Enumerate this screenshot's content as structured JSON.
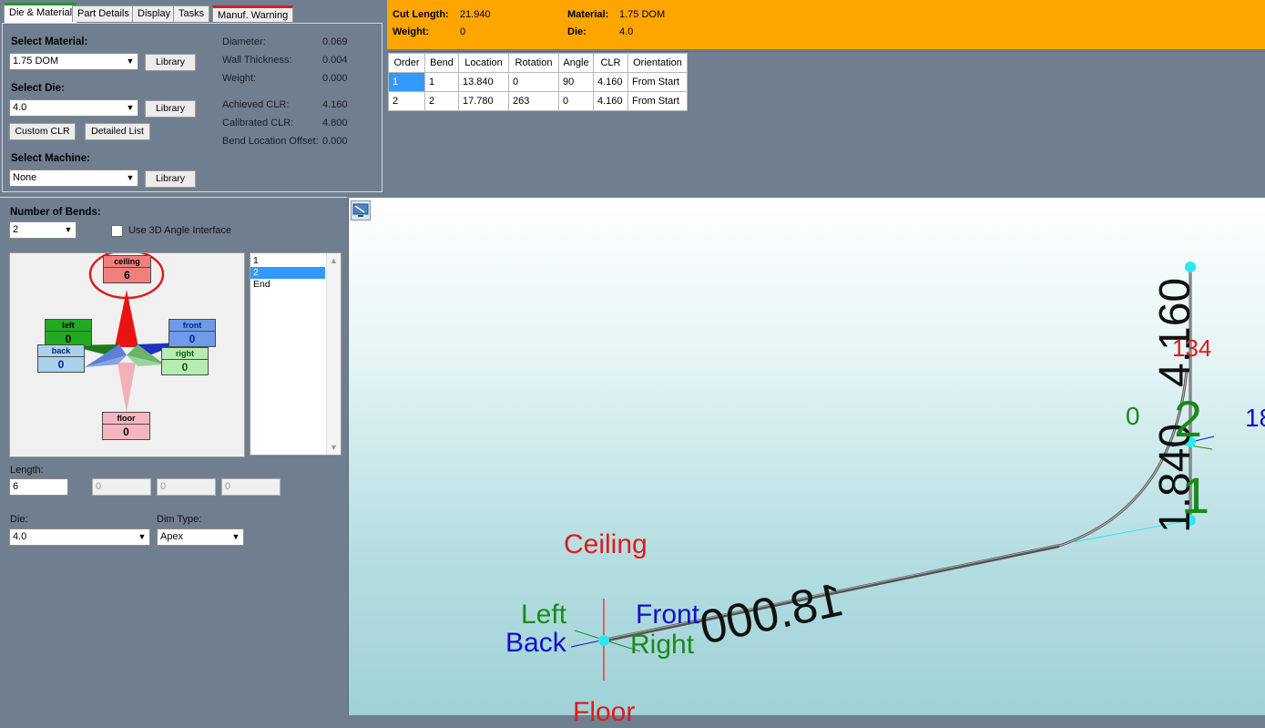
{
  "tabs": [
    {
      "label": "Die & Material"
    },
    {
      "label": "Part Details"
    },
    {
      "label": "Display"
    },
    {
      "label": "Tasks"
    },
    {
      "label": "Manuf. Warning"
    }
  ],
  "material": {
    "select_material_label": "Select Material:",
    "material_value": "1.75 DOM",
    "select_die_label": "Select Die:",
    "die_value": "4.0",
    "select_machine_label": "Select Machine:",
    "machine_value": "None",
    "library_label": "Library",
    "custom_clr_label": "Custom CLR",
    "detailed_list_label": "Detailed List"
  },
  "props": [
    {
      "label": "Diameter:",
      "value": "0.069"
    },
    {
      "label": "Wall Thickness:",
      "value": "0.004"
    },
    {
      "label": "Weight:",
      "value": "0.000"
    },
    {
      "label": "Achieved CLR:",
      "value": "4.160"
    },
    {
      "label": "Calibrated CLR:",
      "value": "4.800"
    },
    {
      "label": "Bend Location Offset:",
      "value": "0.000"
    }
  ],
  "info": {
    "cut_length_label": "Cut Length:",
    "cut_length_value": "21.940",
    "weight_label": "Weight:",
    "weight_value": "0",
    "material_label": "Material:",
    "material_value": "1.75 DOM",
    "die_label": "Die:",
    "die_value": "4.0"
  },
  "bend_table": {
    "headers": [
      "Order",
      "Bend",
      "Location",
      "Rotation",
      "Angle",
      "CLR",
      "Orientation"
    ],
    "rows": [
      [
        "1",
        "1",
        "13.840",
        "0",
        "90",
        "4.160",
        "From Start"
      ],
      [
        "2",
        "2",
        "17.780",
        "263",
        "0",
        "4.160",
        "From Start"
      ]
    ]
  },
  "bends_panel": {
    "number_of_bends_label": "Number of Bends:",
    "number_of_bends_value": "2",
    "use_3d_label": "Use 3D Angle Interface",
    "directions": {
      "ceiling": {
        "label": "ceiling",
        "value": "6",
        "color": "#f08080"
      },
      "left": {
        "label": "left",
        "value": "0",
        "color": "#22aa22"
      },
      "front": {
        "label": "front",
        "value": "0",
        "color": "#6f9ae8"
      },
      "back": {
        "label": "back",
        "value": "0",
        "color": "#a9d1ec"
      },
      "right": {
        "label": "right",
        "value": "0",
        "color": "#b5ecb0"
      },
      "floor": {
        "label": "floor",
        "value": "0",
        "color": "#f5b6c4"
      }
    },
    "list_items": [
      "1",
      "2",
      "End"
    ],
    "length_label": "Length:",
    "length_value": "6",
    "disabled_values": [
      "0",
      "0",
      "0"
    ],
    "die_label": "Die:",
    "die_value": "4.0",
    "dim_type_label": "Dim Type:",
    "dim_type_value": "Apex"
  },
  "view": {
    "ceiling": "Ceiling",
    "floor": "Floor",
    "left": "Left",
    "back": "Back",
    "front": "Front",
    "right": "Right",
    "dim_long": "18.000",
    "dim_vertical": "1.840",
    "dim_clr": "4.160",
    "bend_num_1": "1",
    "bend_num_2": "2",
    "side_zero": "0",
    "side_18": "18",
    "red_134": "134"
  },
  "colors": {
    "orange_bar": "#ffa500",
    "panel_bg": "#707f90",
    "selection": "#3399ff",
    "ceiling_red": "#e01a1a",
    "green_label": "#1a8a1a",
    "blue_label": "#1010c8",
    "node_cyan": "#2ee6f0"
  }
}
